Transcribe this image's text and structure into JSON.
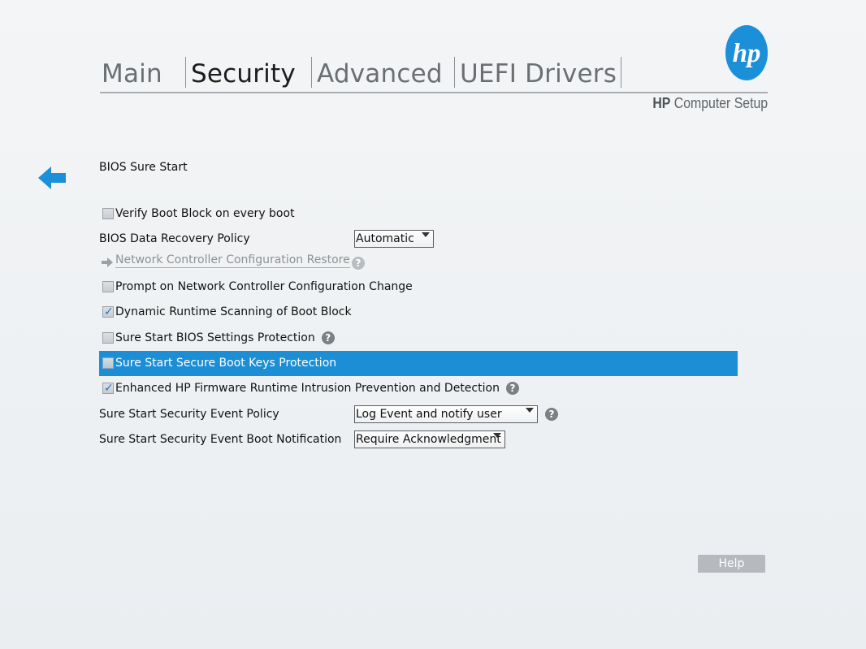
{
  "tabs": [
    {
      "label": "Main",
      "active": false
    },
    {
      "label": "Security",
      "active": true
    },
    {
      "label": "Advanced",
      "active": false
    },
    {
      "label": "UEFI Drivers",
      "active": false
    }
  ],
  "brand": {
    "logo_text": "hp",
    "bold": "HP",
    "rest": "Computer Setup"
  },
  "page": {
    "section_title": "BIOS Sure Start",
    "back_icon": "arrow-left-icon"
  },
  "settings": {
    "verify_boot_block": {
      "label": "Verify Boot Block on every boot",
      "checked": false
    },
    "data_recovery_policy": {
      "label": "BIOS Data Recovery Policy",
      "value": "Automatic"
    },
    "network_restore": {
      "label": "Network Controller Configuration Restore"
    },
    "prompt_network_change": {
      "label": "Prompt on Network Controller Configuration Change",
      "checked": false
    },
    "dynamic_scanning": {
      "label": "Dynamic Runtime Scanning of Boot Block",
      "checked": true
    },
    "bios_settings_protection": {
      "label": "Sure Start BIOS Settings Protection",
      "checked": false
    },
    "secure_boot_keys_protection": {
      "label": "Sure Start Secure Boot Keys Protection",
      "checked": false,
      "selected": true
    },
    "enhanced_firmware": {
      "label": "Enhanced HP Firmware Runtime Intrusion Prevention and Detection",
      "checked": true
    },
    "event_policy": {
      "label": "Sure Start Security Event Policy",
      "value": "Log Event and notify user"
    },
    "boot_notification": {
      "label": "Sure Start Security Event Boot Notification",
      "value": "Require Acknowledgment"
    }
  },
  "icons": {
    "help": "?",
    "check": "✓"
  },
  "colors": {
    "accent": "#1c8ed6",
    "logo": "#1c8fd9",
    "background": "#f0f2f4"
  },
  "footer": {
    "help_label": "Help"
  }
}
